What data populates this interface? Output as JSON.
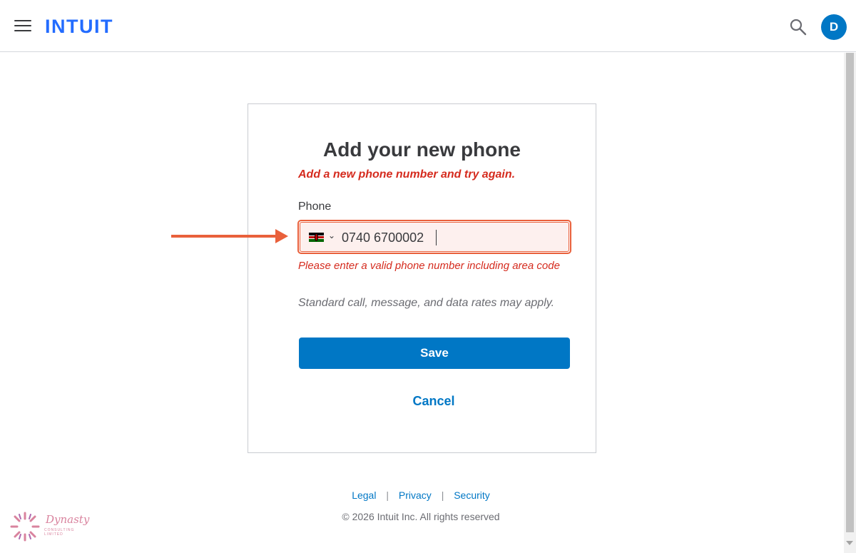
{
  "header": {
    "logo_text": "INTUIT",
    "avatar_initial": "D",
    "brand_color": "#236cff",
    "accent_color": "#0077c5"
  },
  "icons": {
    "menu": "hamburger-menu-icon",
    "search": "search-icon",
    "country_flag": "kenya-flag-icon",
    "dropdown": "chevron-down-icon"
  },
  "card": {
    "title": "Add your new phone",
    "error_banner": "Add a new phone number and try again.",
    "phone_label": "Phone",
    "phone_value": "0740 6700002",
    "field_error": "Please enter a valid phone number including area code",
    "rates_notice": "Standard call, message, and data rates may apply.",
    "save_label": "Save",
    "cancel_label": "Cancel",
    "error_color": "#d52b1e"
  },
  "footer": {
    "legal": "Legal",
    "privacy": "Privacy",
    "security": "Security",
    "separator": "|",
    "copyright": "© 2026 Intuit Inc. All rights reserved"
  },
  "watermark": {
    "name": "Dynasty",
    "sub": "CONSULTING LIMITED"
  }
}
